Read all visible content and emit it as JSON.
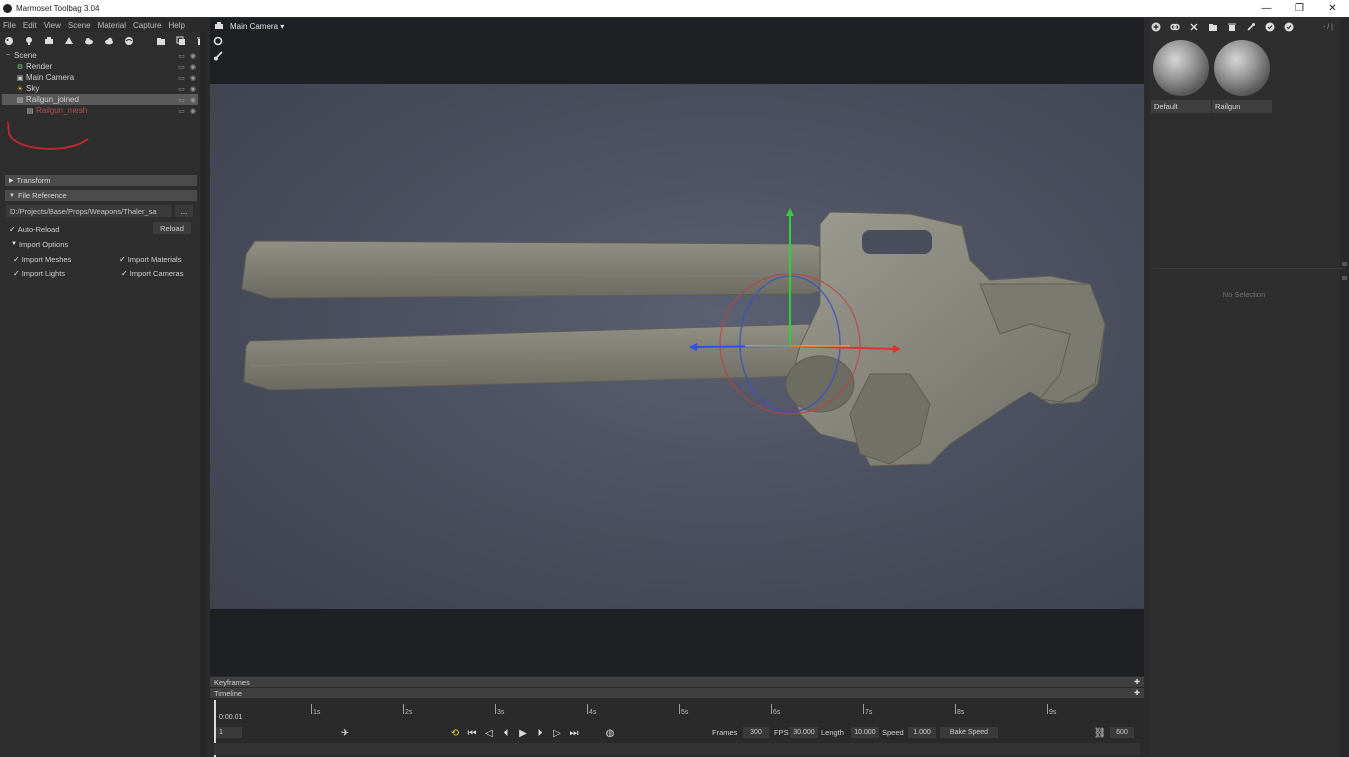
{
  "window": {
    "title": "Marmoset Toolbag 3.04",
    "controls": [
      "—",
      "❐",
      "✕"
    ]
  },
  "menu": [
    "File",
    "Edit",
    "View",
    "Scene",
    "Material",
    "Capture",
    "Help"
  ],
  "left_toolbar_icons": [
    "paint-icon",
    "light-icon",
    "camera-icon",
    "shadow-catcher-icon",
    "fog-icon",
    "cloud-icon",
    "sky-icon",
    "folder-icon",
    "duplicate-icon",
    "trash-icon"
  ],
  "scene_tree": {
    "items": [
      {
        "label": "Scene",
        "icon": "▫"
      },
      {
        "label": "Render",
        "icon": "⚙"
      },
      {
        "label": "Main Camera",
        "icon": "▣"
      },
      {
        "label": "Sky",
        "icon": "☀"
      },
      {
        "label": "Railgun_joined",
        "icon": "▤"
      },
      {
        "label": "Railgun_mesh",
        "icon": "▤"
      }
    ],
    "selected": "Railgun_joined"
  },
  "properties": {
    "transform_header": "Transform",
    "file_reference_header": "File Reference",
    "file_path": "D:/Projects/Base/Props/Weapons/Thaler_sa",
    "dots_label": "...",
    "auto_reload_label": "Auto-Reload",
    "reload_button": "Reload",
    "import_options_header": "Import Options",
    "import_meshes": "Import Meshes",
    "import_materials": "Import Materials",
    "import_lights": "Import Lights",
    "import_cameras": "Import Cameras"
  },
  "viewport": {
    "camera_label": "Main Camera ▾"
  },
  "timeline": {
    "keyframes_label": "Keyframes",
    "timeline_label": "Timeline",
    "current_time": "0:00.01",
    "ticks": [
      "1s",
      "2s",
      "3s",
      "4s",
      "5s",
      "6s",
      "7s",
      "8s",
      "9s"
    ],
    "frame_field": "1",
    "frames_label": "Frames",
    "frames_value": "300",
    "fps_label": "FPS",
    "fps_value": "30.000",
    "length_label": "Length",
    "length_value": "10.000",
    "speed_label": "Speed",
    "speed_value": "1.000",
    "bake_speed": "Bake Speed",
    "end_value": "600"
  },
  "materials": {
    "toolbar_icons": [
      "add-icon",
      "link-icon",
      "unlink-icon",
      "folder-icon",
      "trash-icon",
      "eyedropper-icon",
      "check-icon",
      "check-icon"
    ],
    "toolbar_extra": "- / |",
    "items": [
      {
        "name": "Default"
      },
      {
        "name": "Railgun"
      }
    ],
    "no_selection": "No Selection"
  },
  "colors": {
    "accent_selection": "#5a5a5a",
    "annotation_red": "#c0262f",
    "gizmo_x": "#e03030",
    "gizmo_y": "#30d030",
    "gizmo_z": "#3050e0"
  }
}
